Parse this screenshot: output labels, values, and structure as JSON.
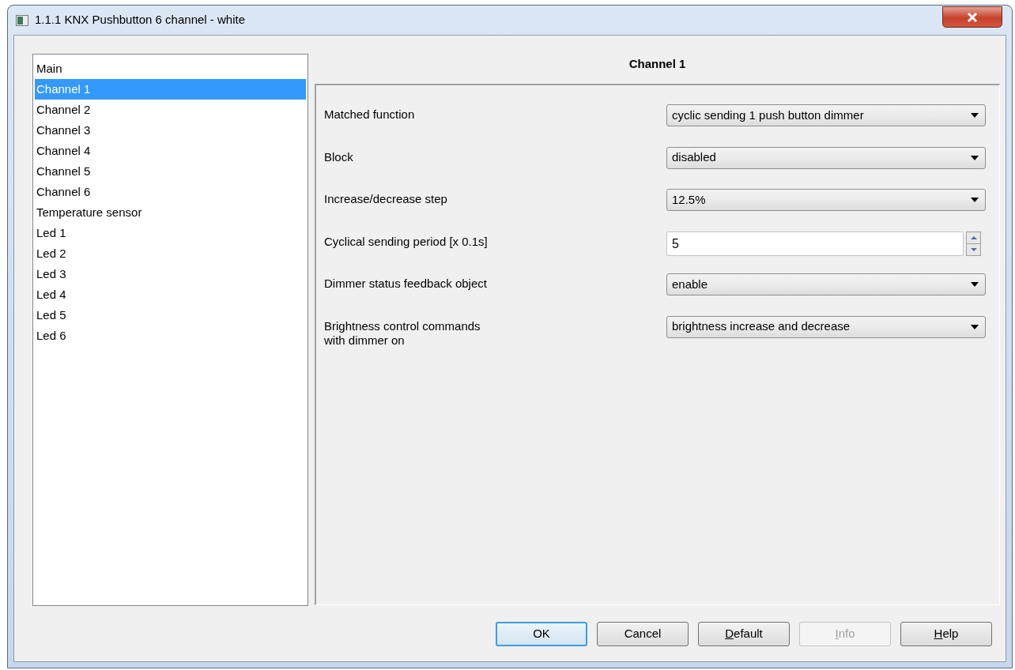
{
  "window": {
    "title": "1.1.1 KNX Pushbutton 6 channel - white"
  },
  "sidebar": {
    "items": [
      {
        "label": "Main",
        "selected": false
      },
      {
        "label": "Channel 1",
        "selected": true
      },
      {
        "label": "Channel 2",
        "selected": false
      },
      {
        "label": "Channel 3",
        "selected": false
      },
      {
        "label": "Channel 4",
        "selected": false
      },
      {
        "label": "Channel 5",
        "selected": false
      },
      {
        "label": "Channel 6",
        "selected": false
      },
      {
        "label": "Temperature sensor",
        "selected": false
      },
      {
        "label": "Led 1",
        "selected": false
      },
      {
        "label": "Led 2",
        "selected": false
      },
      {
        "label": "Led 3",
        "selected": false
      },
      {
        "label": "Led 4",
        "selected": false
      },
      {
        "label": "Led 5",
        "selected": false
      },
      {
        "label": "Led 6",
        "selected": false
      }
    ]
  },
  "panel": {
    "title": "Channel 1",
    "parameters": [
      {
        "label": "Matched function",
        "kind": "dropdown",
        "value": "cyclic sending 1 push button dimmer"
      },
      {
        "label": "Block",
        "kind": "dropdown",
        "value": "disabled"
      },
      {
        "label": "Increase/decrease step",
        "kind": "dropdown",
        "value": "12.5%"
      },
      {
        "label": "Cyclical sending period [x 0.1s]",
        "kind": "spinner",
        "value": "5"
      },
      {
        "label": "Dimmer status feedback object",
        "kind": "dropdown",
        "value": "enable"
      },
      {
        "label": "Brightness control commands\nwith dimmer on",
        "kind": "dropdown",
        "value": "brightness increase and decrease"
      }
    ]
  },
  "buttons": [
    {
      "label": "OK",
      "default": true,
      "disabled": false,
      "mnemonic": false
    },
    {
      "label": "Cancel",
      "default": false,
      "disabled": false,
      "mnemonic": false
    },
    {
      "label": "Default",
      "default": false,
      "disabled": false,
      "mnemonic": true
    },
    {
      "label": "Info",
      "default": false,
      "disabled": true,
      "mnemonic": true
    },
    {
      "label": "Help",
      "default": false,
      "disabled": false,
      "mnemonic": true
    }
  ]
}
